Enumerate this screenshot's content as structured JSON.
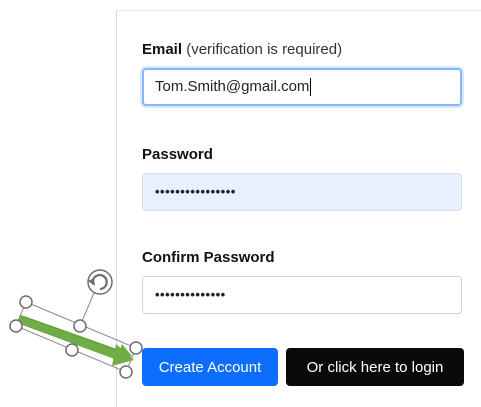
{
  "form": {
    "email_label": "Email",
    "email_hint": "(verification is required)",
    "email_value": "Tom.Smith@gmail.com",
    "password_label": "Password",
    "password_value": "••••••••••••••••",
    "confirm_label": "Confirm Password",
    "confirm_value": "••••••••••••••"
  },
  "actions": {
    "create_label": "Create Account",
    "login_label": "Or click here to login"
  },
  "colors": {
    "primary": "#0d6efd",
    "dark": "#0a0a0a",
    "autofill": "#e8f0fe",
    "focus_border": "#86b7fe",
    "arrow": "#70ad47"
  },
  "overlay": {
    "icon": "green-arrow-shape-with-rotate-handle"
  }
}
